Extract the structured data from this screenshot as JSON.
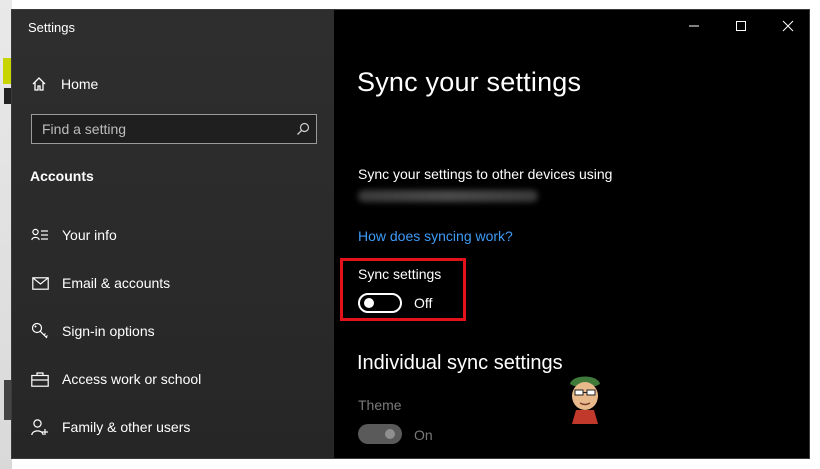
{
  "window": {
    "title": "Settings"
  },
  "sidebar": {
    "home_label": "Home",
    "search_placeholder": "Find a setting",
    "section_title": "Accounts",
    "items": [
      {
        "label": "Your info",
        "icon": "person-lines-icon"
      },
      {
        "label": "Email & accounts",
        "icon": "mail-icon"
      },
      {
        "label": "Sign-in options",
        "icon": "key-icon"
      },
      {
        "label": "Access work or school",
        "icon": "briefcase-icon"
      },
      {
        "label": "Family & other users",
        "icon": "person-add-icon"
      }
    ]
  },
  "content": {
    "title": "Sync your settings",
    "description": "Sync your settings to other devices using",
    "help_link": "How does syncing work?",
    "sync_settings": {
      "label": "Sync settings",
      "state": "Off"
    },
    "individual_title": "Individual sync settings",
    "theme": {
      "label": "Theme",
      "state": "On"
    }
  },
  "colors": {
    "link": "#3e9bf7",
    "highlight": "#e3121b",
    "sidebar_bg": "#2b2b2b",
    "content_bg": "#000000"
  }
}
